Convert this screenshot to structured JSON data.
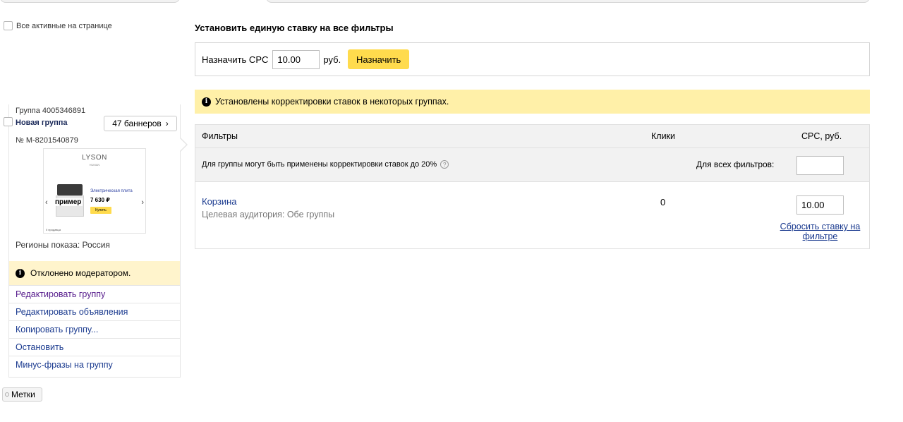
{
  "left": {
    "select_all_label": "Все активные на странице",
    "group": {
      "id_label": "Группа 4005346891",
      "name": "Новая группа",
      "banners_button": "47 баннеров",
      "ad_number": "№ М-8201540879",
      "banner": {
        "brand": "LYSON",
        "brand_sub": "HUMAN",
        "overlay_text": "пример",
        "product_title": "Электрическая плита",
        "price": "7 630 ₽",
        "buy_button": "Купить",
        "sellers": "0 продавца"
      },
      "regions": "Регионы показа: Россия",
      "status_message": "Отклонено модератором.",
      "actions": [
        "Редактировать группу",
        "Редактировать объявления",
        "Копировать группу...",
        "Остановить",
        "Минус-фразы на группу"
      ]
    },
    "tags_button": "Метки"
  },
  "right": {
    "title": "Установить единую ставку на все фильтры",
    "cpc_label": "Назначить CPC",
    "cpc_value": "10.00",
    "currency": "руб.",
    "assign_button": "Назначить",
    "notice": "Установлены корректировки ставок в некоторых группах.",
    "table": {
      "headers": [
        "Фильтры",
        "Клики",
        "CPC, руб."
      ],
      "hint": "Для группы могут быть применены корректировки ставок до 20%",
      "all_filters_label": "Для всех фильтров:",
      "rows": [
        {
          "name": "Корзина",
          "audience": "Целевая аудитория: Обе группы",
          "clicks": "0",
          "cpc": "10.00",
          "reset_link": "Сбросить ставку на фильтре"
        }
      ]
    }
  },
  "colors": {
    "accent_yellow": "#ffdb4d",
    "notice_bg": "#fff0a8",
    "link_blue": "#1a3a8f",
    "visited_purple": "#551a8b"
  }
}
